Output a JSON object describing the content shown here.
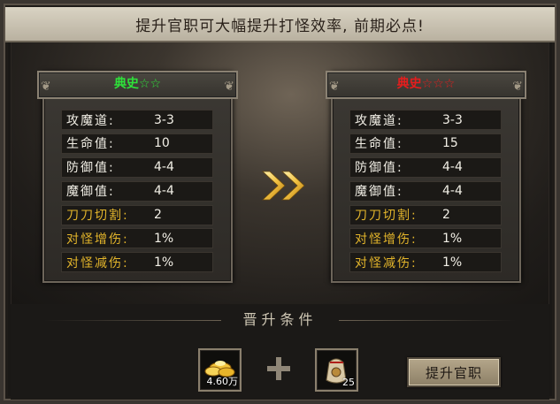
{
  "banner": {
    "text": "提升官职可大幅提升打怪效率, 前期必点!"
  },
  "current_rank": {
    "name": "典史",
    "stars": "☆☆",
    "stats": [
      {
        "label": "攻魔道:",
        "value": "3-3"
      },
      {
        "label": "生命值:",
        "value": "10"
      },
      {
        "label": "防御值:",
        "value": "4-4"
      },
      {
        "label": "魔御值:",
        "value": "4-4"
      },
      {
        "label": "刀刀切割:",
        "value": "2"
      },
      {
        "label": "对怪增伤:",
        "value": "1%"
      },
      {
        "label": "对怪减伤:",
        "value": "1%"
      }
    ]
  },
  "next_rank": {
    "name": "典史",
    "stars": "☆☆☆",
    "stats": [
      {
        "label": "攻魔道:",
        "value": "3-3"
      },
      {
        "label": "生命值:",
        "value": "15"
      },
      {
        "label": "防御值:",
        "value": "4-4"
      },
      {
        "label": "魔御值:",
        "value": "4-4"
      },
      {
        "label": "刀刀切割:",
        "value": "2"
      },
      {
        "label": "对怪增伤:",
        "value": "1%"
      },
      {
        "label": "对怪减伤:",
        "value": "1%"
      }
    ]
  },
  "conditions": {
    "title": "晋升条件",
    "gold_amount": "4.60万",
    "item_count": "25"
  },
  "promote_button": {
    "label": "提升官职"
  },
  "colors": {
    "current_title": "#2ee23a",
    "next_title": "#e61d1d",
    "special_stat": "#e3b52b"
  },
  "icons": [
    "double-chevron-right-icon",
    "gold-ingots-icon",
    "plus-icon",
    "token-pouch-icon",
    "scroll-curl-icon"
  ]
}
